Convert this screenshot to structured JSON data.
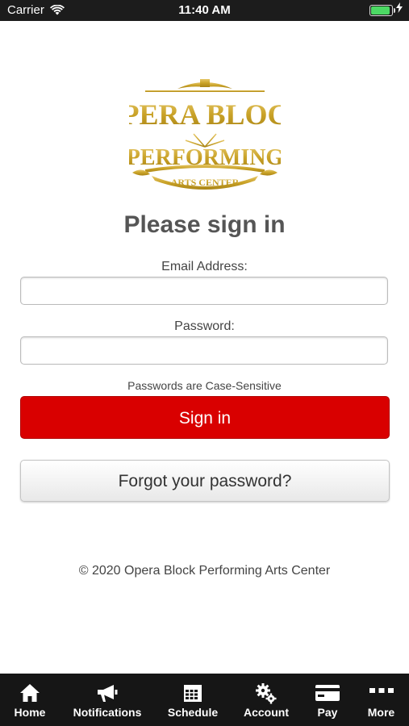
{
  "status_bar": {
    "carrier": "Carrier",
    "time": "11:40 AM",
    "battery_level": 1.0
  },
  "logo": {
    "line1": "OPERA BLOCK",
    "line2": "PERFORMING",
    "line3": "ARTS CENTER",
    "color": "#c9a227"
  },
  "form": {
    "title": "Please sign in",
    "email_label": "Email Address:",
    "email_value": "",
    "password_label": "Password:",
    "password_value": "",
    "hint": "Passwords are Case-Sensitive",
    "signin_label": "Sign in",
    "forgot_label": "Forgot your password?"
  },
  "footer": {
    "copyright": "© 2020 Opera Block Performing Arts Center"
  },
  "tab_bar": {
    "items": [
      {
        "label": "Home",
        "icon": "home-icon"
      },
      {
        "label": "Notifications",
        "icon": "megaphone-icon"
      },
      {
        "label": "Schedule",
        "icon": "calendar-icon"
      },
      {
        "label": "Account",
        "icon": "gears-icon"
      },
      {
        "label": "Pay",
        "icon": "credit-card-icon"
      },
      {
        "label": "More",
        "icon": "more-icon"
      }
    ]
  },
  "colors": {
    "primary_button": "#d90000",
    "tab_bar_bg": "#161616",
    "status_bar_bg": "#1c1c1c",
    "battery": "#4cd964"
  }
}
